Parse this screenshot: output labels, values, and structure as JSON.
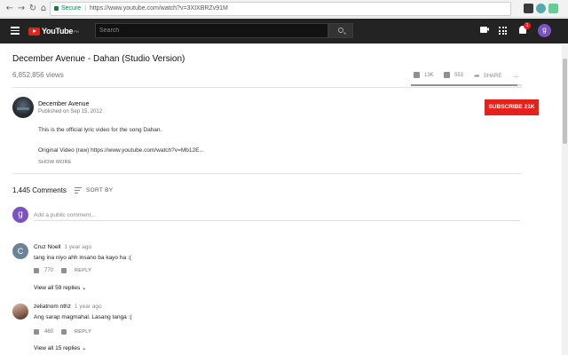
{
  "browser": {
    "secure_label": "Secure",
    "url": "https://www.youtube.com/watch?v=3XIXBRZv91M"
  },
  "header": {
    "logo_text": "YouTube",
    "logo_country": "PH",
    "search_placeholder": "Search",
    "notification_count": "1",
    "user_initial": "g"
  },
  "video": {
    "title": "December Avenue - Dahan (Studio Version)",
    "views": "6,852,856 views",
    "likes": "13K",
    "dislikes": "553",
    "share_label": "SHARE",
    "more_label": "...",
    "like_fraction": 0.96
  },
  "channel": {
    "name": "December Avenue",
    "published": "Published on Sep 15, 2012",
    "subscribe_label": "SUBSCRIBE",
    "subscriber_count": "21K",
    "description_lines": [
      "This is the official lyric video for the song Dahan.",
      "Original Video (raw) https://www.youtube.com/watch?v=Mb12E..."
    ],
    "show_more_label": "SHOW MORE"
  },
  "comments": {
    "count_label": "1,445 Comments",
    "sort_label": "SORT BY",
    "add_placeholder": "Add a public comment...",
    "my_initial": "g",
    "reply_label": "REPLY",
    "items": [
      {
        "initial": "C",
        "avatar_color": "#6b8396",
        "author": "Cruz Noell",
        "time": "1 year ago",
        "text": "tang ina niyo ahh insano ba kayo ha :(",
        "likes": "770",
        "view_replies": "View all 59 replies"
      },
      {
        "initial": "",
        "avatar_color": "#b98f7e",
        "author": "zeliatnom nthz",
        "time": "1 year ago",
        "text": "Ang sarap magmahal. Lasang tanga :(",
        "likes": "460",
        "view_replies": "View all 15 replies"
      }
    ]
  }
}
